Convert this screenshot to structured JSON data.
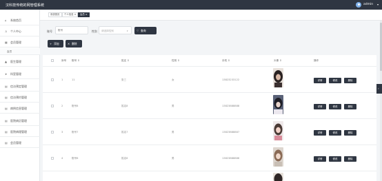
{
  "header": {
    "title": "汉科技传统的网管理系统",
    "username": "admin",
    "user_caret": "▾"
  },
  "sidebar": {
    "items": [
      {
        "icon": "home-icon",
        "glyph": "⌂",
        "label": "系统首页"
      },
      {
        "icon": "user-icon",
        "glyph": "♙",
        "label": "个人中心"
      },
      {
        "icon": "grid-icon",
        "glyph": "▦",
        "label": "会员管理"
      },
      {
        "icon": "person-icon",
        "glyph": "▲",
        "label": "医生管理"
      },
      {
        "icon": "send-icon",
        "glyph": "➤",
        "label": "科室管理"
      },
      {
        "icon": "list-icon",
        "glyph": "▤",
        "label": "信访预定管理"
      },
      {
        "icon": "list-icon",
        "glyph": "▤",
        "label": "信访预约管理"
      },
      {
        "icon": "list-icon",
        "glyph": "▤",
        "label": "病例信息管理"
      },
      {
        "icon": "list-icon",
        "glyph": "▤",
        "label": "医院病历管理"
      },
      {
        "icon": "list-icon",
        "glyph": "▤",
        "label": "医院病理管理"
      },
      {
        "icon": "list-icon",
        "glyph": "▤",
        "label": "会员管理"
      }
    ],
    "sub_item": "会员"
  },
  "tabs": [
    {
      "label": "系统首页"
    },
    {
      "label": "个人信息 ×"
    },
    {
      "label": "会员 ×"
    }
  ],
  "search": {
    "label1": "账号",
    "placeholder1": "账号",
    "label2": "性别",
    "placeholder2": "请选择性别",
    "select_caret": "▾",
    "search_icon": "♡",
    "search_button": "查询"
  },
  "actions": {
    "add_icon": "+",
    "add_label": "添加",
    "delete_icon": "✕",
    "delete_label": "删除"
  },
  "table": {
    "headers": [
      "序号",
      "账号 ⇕",
      "姓名 ⇕",
      "性别 ⇕",
      "手机 ⇕",
      "头像 ⇕",
      "操作"
    ],
    "rows": [
      {
        "index": "1",
        "account": "11",
        "name": "张三",
        "gender": "女",
        "phone": "13823233122"
      },
      {
        "index": "2",
        "account": "账号8",
        "name": "姓名8",
        "gender": "男",
        "phone": "13823888888"
      },
      {
        "index": "3",
        "account": "账号7",
        "name": "姓名7",
        "gender": "男",
        "phone": "13823888887"
      },
      {
        "index": "4",
        "account": "账号6",
        "name": "姓名6",
        "gender": "男",
        "phone": "13823888886"
      }
    ],
    "row_actions": {
      "detail": "详情",
      "edit": "修改",
      "delete": "删除"
    }
  },
  "side_handle_glyph": "›",
  "colors": {
    "topbar": "#2f3642",
    "accent_button": "#2f3642",
    "background": "#f3f5f7"
  }
}
